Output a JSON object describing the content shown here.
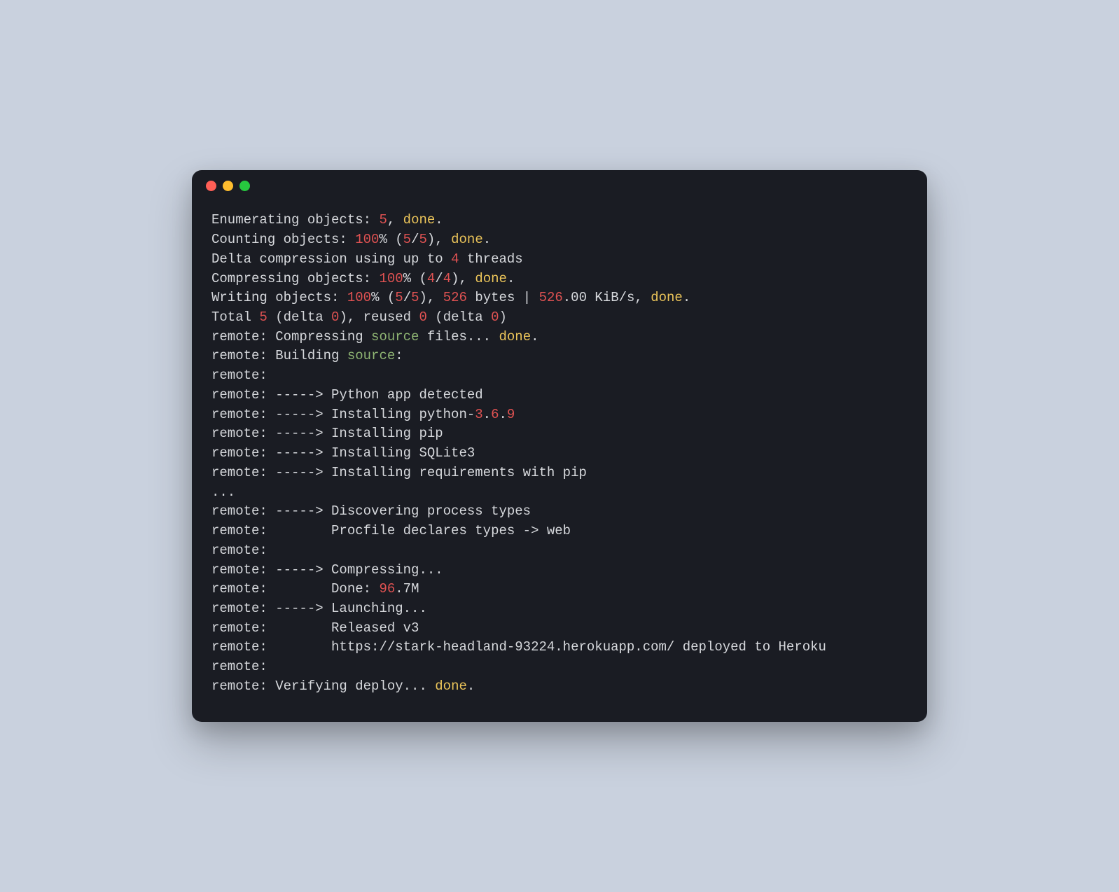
{
  "colors": {
    "background": "#c9d1de",
    "terminal_bg": "#1a1c23",
    "text": "#d7d9dd",
    "red": "#e05252",
    "yellow": "#ecc55a",
    "green": "#8fb573",
    "blue": "#6aa3d0",
    "dot_red": "#ff5f56",
    "dot_yellow": "#ffbd2e",
    "dot_green": "#27c93f"
  },
  "lines": [
    [
      [
        "plain",
        "Enumerating objects: "
      ],
      [
        "red",
        "5"
      ],
      [
        "plain",
        ", "
      ],
      [
        "yellow",
        "done"
      ],
      [
        "plain",
        "."
      ]
    ],
    [
      [
        "plain",
        "Counting objects: "
      ],
      [
        "red",
        "100"
      ],
      [
        "plain",
        "% ("
      ],
      [
        "red",
        "5"
      ],
      [
        "plain",
        "/"
      ],
      [
        "red",
        "5"
      ],
      [
        "plain",
        "), "
      ],
      [
        "yellow",
        "done"
      ],
      [
        "plain",
        "."
      ]
    ],
    [
      [
        "plain",
        "Delta compression using up to "
      ],
      [
        "red",
        "4"
      ],
      [
        "plain",
        " threads"
      ]
    ],
    [
      [
        "plain",
        "Compressing objects: "
      ],
      [
        "red",
        "100"
      ],
      [
        "plain",
        "% ("
      ],
      [
        "red",
        "4"
      ],
      [
        "plain",
        "/"
      ],
      [
        "red",
        "4"
      ],
      [
        "plain",
        "), "
      ],
      [
        "yellow",
        "done"
      ],
      [
        "plain",
        "."
      ]
    ],
    [
      [
        "plain",
        "Writing objects: "
      ],
      [
        "red",
        "100"
      ],
      [
        "plain",
        "% ("
      ],
      [
        "red",
        "5"
      ],
      [
        "plain",
        "/"
      ],
      [
        "red",
        "5"
      ],
      [
        "plain",
        "), "
      ],
      [
        "red",
        "526"
      ],
      [
        "plain",
        " bytes | "
      ],
      [
        "red",
        "526"
      ],
      [
        "plain",
        ".00 KiB/s, "
      ],
      [
        "yellow",
        "done"
      ],
      [
        "plain",
        "."
      ]
    ],
    [
      [
        "plain",
        "Total "
      ],
      [
        "red",
        "5"
      ],
      [
        "plain",
        " (delta "
      ],
      [
        "red",
        "0"
      ],
      [
        "plain",
        "), reused "
      ],
      [
        "red",
        "0"
      ],
      [
        "plain",
        " (delta "
      ],
      [
        "red",
        "0"
      ],
      [
        "plain",
        ")"
      ]
    ],
    [
      [
        "plain",
        "remote: Compressing "
      ],
      [
        "green",
        "source"
      ],
      [
        "plain",
        " files... "
      ],
      [
        "yellow",
        "done"
      ],
      [
        "plain",
        "."
      ]
    ],
    [
      [
        "plain",
        "remote: Building "
      ],
      [
        "green",
        "source"
      ],
      [
        "plain",
        ":"
      ]
    ],
    [
      [
        "plain",
        "remote:"
      ]
    ],
    [
      [
        "plain",
        "remote: -----> Python app detected"
      ]
    ],
    [
      [
        "plain",
        "remote: -----> Installing python-"
      ],
      [
        "red",
        "3"
      ],
      [
        "plain",
        "."
      ],
      [
        "red",
        "6"
      ],
      [
        "plain",
        "."
      ],
      [
        "red",
        "9"
      ]
    ],
    [
      [
        "plain",
        "remote: -----> Installing pip"
      ]
    ],
    [
      [
        "plain",
        "remote: -----> Installing SQLite3"
      ]
    ],
    [
      [
        "plain",
        "remote: -----> Installing requirements with pip"
      ]
    ],
    [
      [
        "plain",
        "..."
      ]
    ],
    [
      [
        "plain",
        "remote: -----> Discovering process types"
      ]
    ],
    [
      [
        "plain",
        "remote:        Procfile declares types -> web"
      ]
    ],
    [
      [
        "plain",
        "remote:"
      ]
    ],
    [
      [
        "plain",
        "remote: -----> Compressing..."
      ]
    ],
    [
      [
        "plain",
        "remote:        Done: "
      ],
      [
        "red",
        "96"
      ],
      [
        "plain",
        ".7M"
      ]
    ],
    [
      [
        "plain",
        "remote: -----> Launching..."
      ]
    ],
    [
      [
        "plain",
        "remote:        Released v3"
      ]
    ],
    [
      [
        "plain",
        "remote:        https://stark-headland-93224.herokuapp.com/ deployed to Heroku"
      ]
    ],
    [
      [
        "plain",
        "remote:"
      ]
    ],
    [
      [
        "plain",
        "remote: Verifying deploy... "
      ],
      [
        "yellow",
        "done"
      ],
      [
        "plain",
        "."
      ]
    ]
  ]
}
